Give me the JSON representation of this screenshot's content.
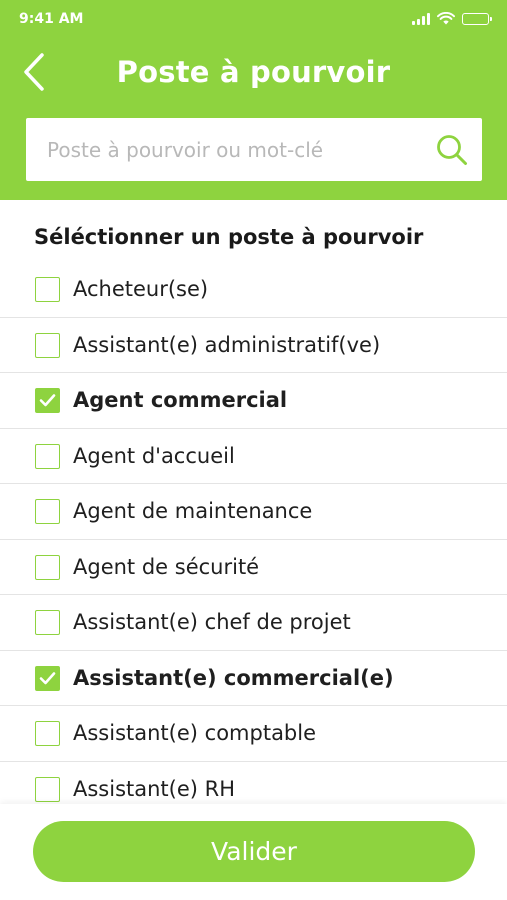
{
  "status_bar": {
    "time": "9:41 AM",
    "icons": [
      "signal-icon",
      "wifi-icon",
      "battery-icon"
    ]
  },
  "header": {
    "back_icon": "chevron-left-icon",
    "title": "Poste à pourvoir"
  },
  "search": {
    "placeholder": "Poste à pourvoir ou mot-clé",
    "value": "",
    "icon": "search-icon"
  },
  "section_title": "Séléctionner un poste à pourvoir",
  "jobs": [
    {
      "label": "Acheteur(se)",
      "checked": false
    },
    {
      "label": "Assistant(e) administratif(ve)",
      "checked": false
    },
    {
      "label": "Agent commercial",
      "checked": true
    },
    {
      "label": "Agent d'accueil",
      "checked": false
    },
    {
      "label": "Agent de maintenance",
      "checked": false
    },
    {
      "label": "Agent de sécurité",
      "checked": false
    },
    {
      "label": "Assistant(e) chef de projet",
      "checked": false
    },
    {
      "label": "Assistant(e) commercial(e)",
      "checked": true
    },
    {
      "label": "Assistant(e) comptable",
      "checked": false
    },
    {
      "label": "Assistant(e) RH",
      "checked": false
    }
  ],
  "footer": {
    "validate_label": "Valider"
  },
  "colors": {
    "accent": "#8ed33f",
    "text": "#1f1f1f",
    "divider": "#e4e4e4"
  }
}
